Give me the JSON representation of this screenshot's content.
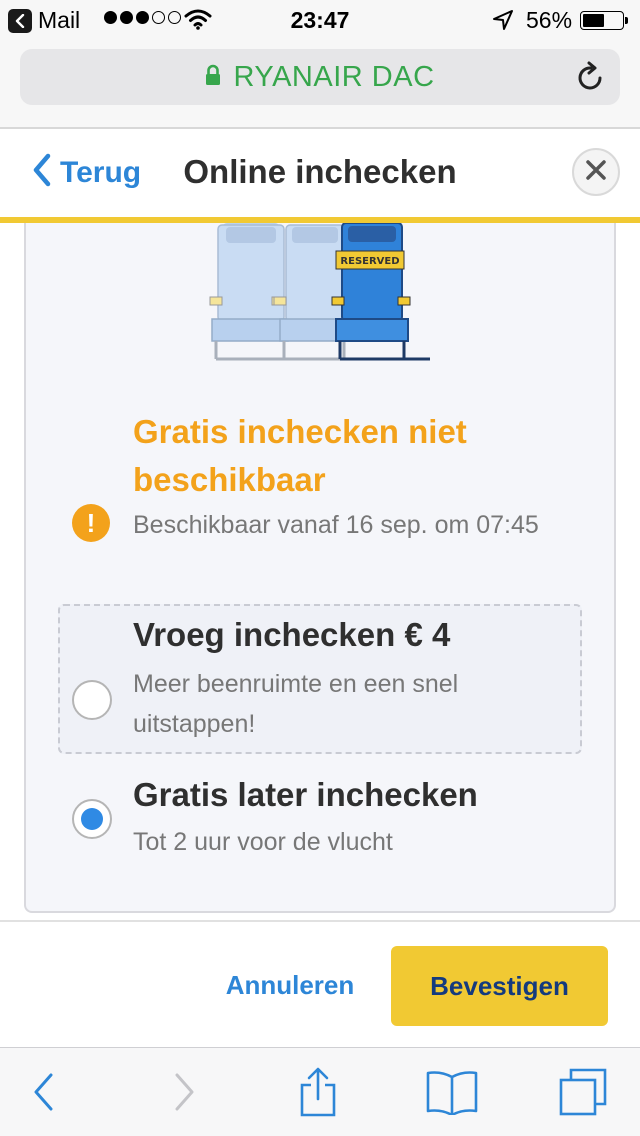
{
  "status_bar": {
    "back_app": "Mail",
    "time": "23:47",
    "battery_percent": "56%",
    "battery_level": 0.56,
    "signal_bars_filled": 3,
    "signal_bars_total": 5
  },
  "url_bar": {
    "site_name": "RYANAIR DAC",
    "secure_color": "#37a64c"
  },
  "header": {
    "back_label": "Terug",
    "title": "Online inchecken",
    "accent_color": "#f1c933"
  },
  "illustration": {
    "badge_text": "RESERVED"
  },
  "notice": {
    "title": "Gratis inchecken niet beschikbaar",
    "icon": "!",
    "description": "Beschikbaar vanaf 16 sep. om 07:45",
    "color": "#f3a21b"
  },
  "options": [
    {
      "title": "Vroeg inchecken € 4",
      "description": "Meer beenruimte en een snel uitstappen!",
      "selected": false
    },
    {
      "title": "Gratis later inchecken",
      "description": "Tot 2 uur voor de vlucht",
      "selected": true
    }
  ],
  "footer": {
    "cancel_label": "Annuleren",
    "confirm_label": "Bevestigen"
  },
  "toolbar": {
    "items": [
      "back-icon",
      "forward-icon",
      "share-icon",
      "bookmarks-icon",
      "tabs-icon"
    ]
  }
}
